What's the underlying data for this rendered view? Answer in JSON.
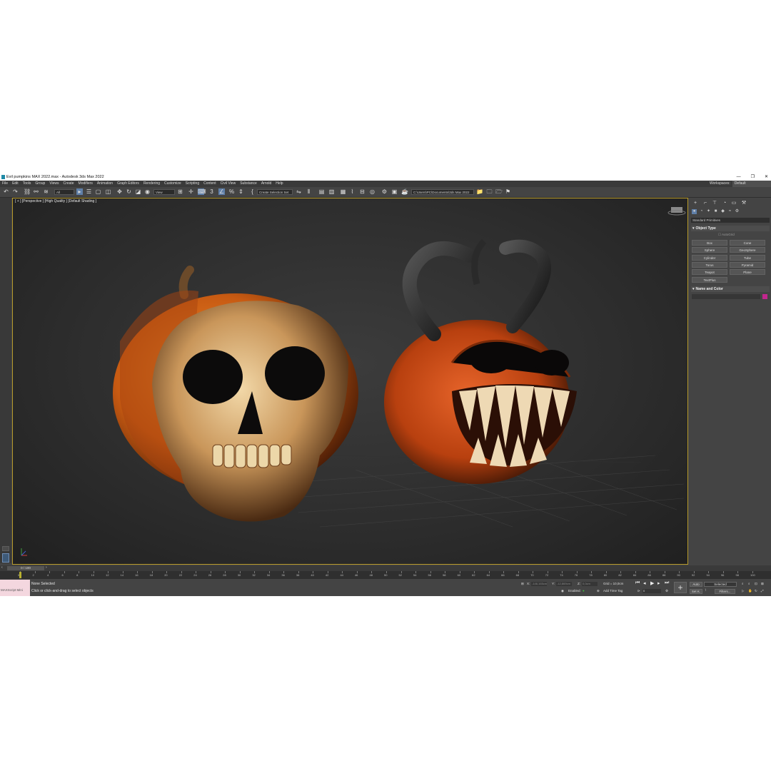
{
  "window": {
    "title": "Evil pumpkins MAX 2022.max - Autodesk 3ds Max 2022",
    "controls": [
      "—",
      "❐",
      "✕"
    ]
  },
  "menu": {
    "items": [
      "File",
      "Edit",
      "Tools",
      "Group",
      "Views",
      "Create",
      "Modifiers",
      "Animation",
      "Graph Editors",
      "Rendering",
      "Customize",
      "Scripting",
      "Content",
      "Civil View",
      "Substance",
      "Arnold",
      "Help"
    ],
    "workspace_label": "Workspaces:",
    "workspace_value": "Default"
  },
  "toolbar": {
    "filter_value": "All",
    "view_value": "View",
    "selection_set_value": "Create Selection Set",
    "path_value": "C:\\Users\\PC\\Documents\\3ds Max 2022"
  },
  "viewport": {
    "label": "[ + ] [Perspective ] [High Quality ] [Default Shading ]"
  },
  "command_panel": {
    "dropdown_value": "Standard Primitives",
    "object_type_title": "Object Type",
    "autogrid_label": "AutoGrid",
    "primitives": [
      "Box",
      "Cone",
      "Sphere",
      "GeoSphere",
      "Cylinder",
      "Tube",
      "Torus",
      "Pyramid",
      "Teapot",
      "Plane",
      "TextPlus"
    ],
    "name_color_title": "Name and Color",
    "color": "#c3268e"
  },
  "timeline": {
    "frame_readout": "0 / 100",
    "ticks": [
      "0",
      "2",
      "4",
      "6",
      "8",
      "10",
      "12",
      "14",
      "16",
      "18",
      "20",
      "22",
      "24",
      "26",
      "28",
      "30",
      "32",
      "34",
      "36",
      "38",
      "40",
      "42",
      "44",
      "46",
      "48",
      "50",
      "52",
      "54",
      "56",
      "58",
      "60",
      "62",
      "64",
      "66",
      "68",
      "70",
      "72",
      "74",
      "76",
      "78",
      "80",
      "82",
      "84",
      "86",
      "88",
      "90",
      "92",
      "94",
      "96",
      "98",
      "100"
    ]
  },
  "status": {
    "maxscript": "MAXScript Mini",
    "selection": "None Selected",
    "prompt": "Click or click-and-drag to select objects",
    "x_label": "X:",
    "x_value": "-146,165cm",
    "y_label": "Y:",
    "y_value": "-12,869cm",
    "z_label": "Z:",
    "z_value": "0,0cm",
    "grid": "Grid = 10,0cm",
    "enabled_label": "Enabled:",
    "add_time_tag": "Add Time Tag",
    "auto_label": "Auto",
    "selected_value": "Selected",
    "setk_label": "Set K.",
    "filters_label": "Filters...",
    "frame_field": "0"
  }
}
